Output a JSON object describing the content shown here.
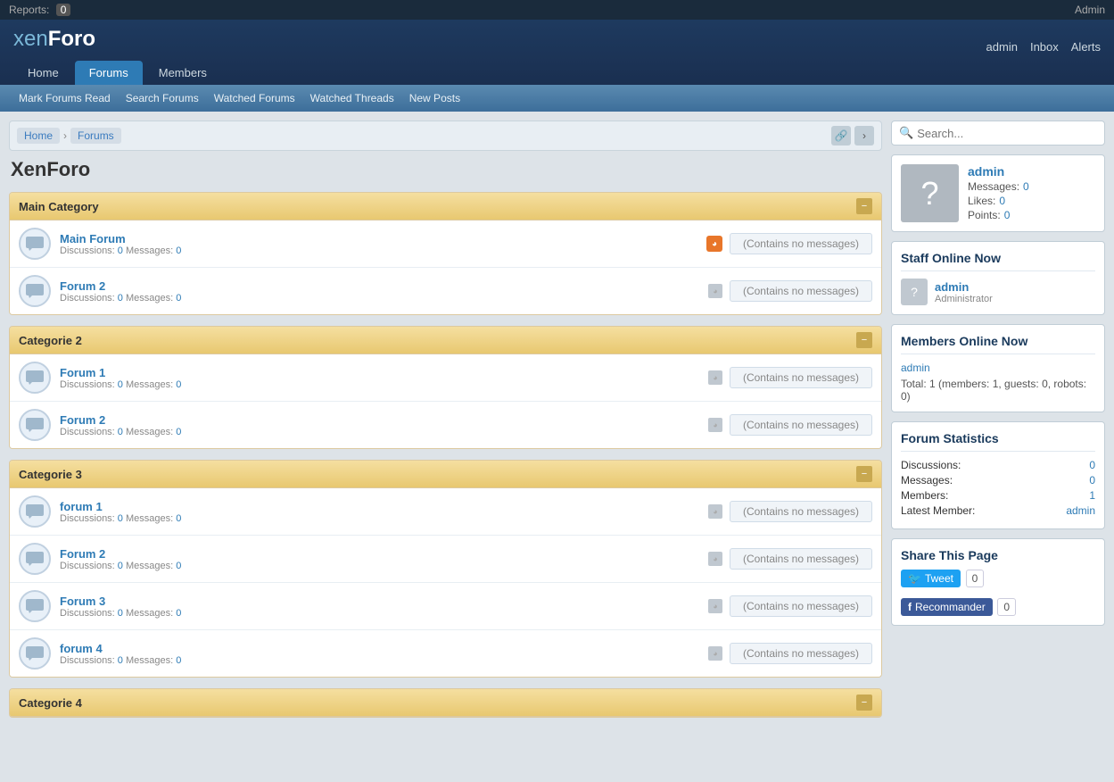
{
  "topbar": {
    "reports_label": "Reports:",
    "reports_count": "0",
    "admin_label": "Admin"
  },
  "logo": {
    "xen": "xen",
    "foro": "Foro"
  },
  "nav": {
    "tabs": [
      {
        "id": "home",
        "label": "Home",
        "active": false
      },
      {
        "id": "forums",
        "label": "Forums",
        "active": true
      },
      {
        "id": "members",
        "label": "Members",
        "active": false
      }
    ],
    "user_links": [
      "admin",
      "Inbox",
      "Alerts"
    ]
  },
  "subnav": {
    "items": [
      "Mark Forums Read",
      "Search Forums",
      "Watched Forums",
      "Watched Threads",
      "New Posts"
    ]
  },
  "breadcrumb": {
    "home": "Home",
    "forums": "Forums"
  },
  "page_title": "XenForo",
  "categories": [
    {
      "id": "cat1",
      "title": "Main Category",
      "forums": [
        {
          "name": "Main Forum",
          "discussions_label": "Discussions:",
          "discussions_val": "0",
          "messages_label": "Messages:",
          "messages_val": "0",
          "status": "(Contains no messages)",
          "has_rss_orange": true
        },
        {
          "name": "Forum 2",
          "discussions_label": "Discussions:",
          "discussions_val": "0",
          "messages_label": "Messages:",
          "messages_val": "0",
          "status": "(Contains no messages)",
          "has_rss_orange": false
        }
      ]
    },
    {
      "id": "cat2",
      "title": "Categorie 2",
      "forums": [
        {
          "name": "Forum 1",
          "discussions_label": "Discussions:",
          "discussions_val": "0",
          "messages_label": "Messages:",
          "messages_val": "0",
          "status": "(Contains no messages)",
          "has_rss_orange": false
        },
        {
          "name": "Forum 2",
          "discussions_label": "Discussions:",
          "discussions_val": "0",
          "messages_label": "Messages:",
          "messages_val": "0",
          "status": "(Contains no messages)",
          "has_rss_orange": false
        }
      ]
    },
    {
      "id": "cat3",
      "title": "Categorie 3",
      "forums": [
        {
          "name": "forum 1",
          "discussions_label": "Discussions:",
          "discussions_val": "0",
          "messages_label": "Messages:",
          "messages_val": "0",
          "status": "(Contains no messages)",
          "has_rss_orange": false
        },
        {
          "name": "Forum 2",
          "discussions_label": "Discussions:",
          "discussions_val": "0",
          "messages_label": "Messages:",
          "messages_val": "0",
          "status": "(Contains no messages)",
          "has_rss_orange": false
        },
        {
          "name": "Forum 3",
          "discussions_label": "Discussions:",
          "discussions_val": "0",
          "messages_label": "Messages:",
          "messages_val": "0",
          "status": "(Contains no messages)",
          "has_rss_orange": false
        },
        {
          "name": "forum 4",
          "discussions_label": "Discussions:",
          "discussions_val": "0",
          "messages_label": "Messages:",
          "messages_val": "0",
          "status": "(Contains no messages)",
          "has_rss_orange": false
        }
      ]
    },
    {
      "id": "cat4",
      "title": "Categorie 4",
      "forums": []
    }
  ],
  "sidebar": {
    "search_placeholder": "Search...",
    "user": {
      "name": "admin",
      "messages_label": "Messages:",
      "messages_val": "0",
      "likes_label": "Likes:",
      "likes_val": "0",
      "points_label": "Points:",
      "points_val": "0"
    },
    "staff_online": {
      "title": "Staff Online Now",
      "members": [
        {
          "name": "admin",
          "role": "Administrator"
        }
      ]
    },
    "members_online": {
      "title": "Members Online Now",
      "online_member": "admin",
      "total_label": "Total: 1 (members: 1, guests: 0, robots: 0)"
    },
    "forum_stats": {
      "title": "Forum Statistics",
      "discussions_label": "Discussions:",
      "discussions_val": "0",
      "messages_label": "Messages:",
      "messages_val": "0",
      "members_label": "Members:",
      "members_val": "1",
      "latest_label": "Latest Member:",
      "latest_val": "admin"
    },
    "share": {
      "title": "Share This Page",
      "tweet_label": "Tweet",
      "tweet_count": "0",
      "fb_label": "Recommander",
      "fb_count": "0"
    }
  }
}
